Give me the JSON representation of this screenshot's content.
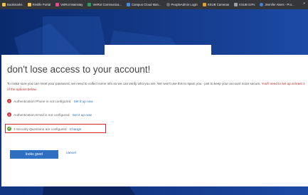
{
  "bookmarks_bar": {
    "items": [
      {
        "label": "Bookmarks",
        "color": "#f0c24b"
      },
      {
        "label": "Reslife Portal",
        "color": "#f0c24b"
      },
      {
        "label": "VetRot Mainstay",
        "color": "#e14b8d"
      },
      {
        "label": "VetRot Communica...",
        "color": "#2e9a5b"
      },
      {
        "label": "Campus Cloud Man...",
        "color": "#3d8ee0"
      },
      {
        "label": "PeopleAdmin Login",
        "color": "#6b6f76"
      },
      {
        "label": "KSUB Cameras",
        "color": "#d9a32f"
      },
      {
        "label": "KSUB GIFs",
        "color": "#9aa0a6"
      },
      {
        "label": "Jennifer Akers - Pro...",
        "color": "#4a7fd6"
      }
    ],
    "more": "»"
  },
  "dialog": {
    "title": "don't lose access to your account!",
    "description": "To make sure you can reset your password, we need to collect some info so we can verify who you are. We won't use this to spam you - just to keep your account more secure.",
    "warning": "You'll need to set up at least 1 of the options below.",
    "options": [
      {
        "text": "Authentication Phone is not configured.",
        "link": "Set it up now",
        "status_icon": "!"
      },
      {
        "text": "Authentication Email is not configured.",
        "link": "Set it up now",
        "status_icon": "!"
      },
      {
        "text": "3 Security Questions are configured.",
        "link": "Change",
        "status_icon": "✓"
      }
    ],
    "primary_button": "looks good",
    "cancel_link": "cancel"
  },
  "colors": {
    "accent": "#2f6fc2",
    "error": "#d0353b",
    "success": "#5fa53a",
    "highlight_border": "#d22a2a"
  }
}
